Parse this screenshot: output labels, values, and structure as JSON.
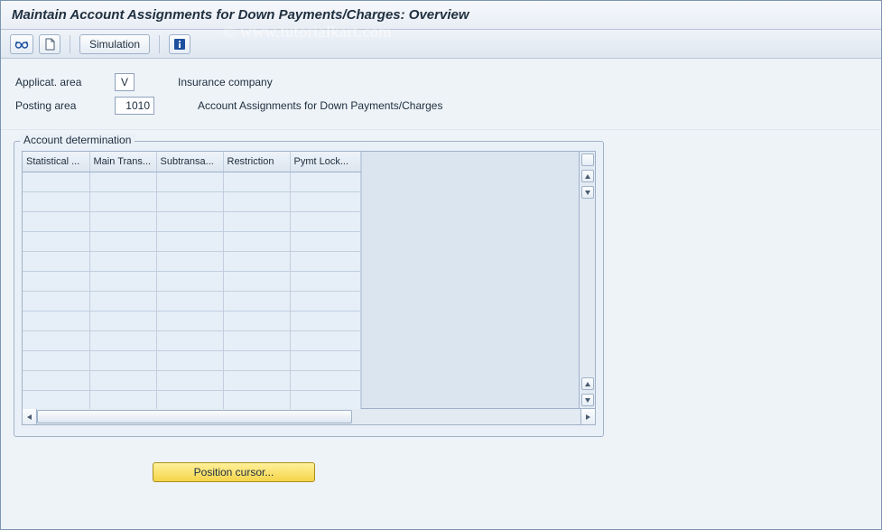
{
  "title": "Maintain Account Assignments for Down Payments/Charges: Overview",
  "watermark": "© www.tutorialkart.com",
  "toolbar": {
    "simulation_label": "Simulation"
  },
  "form": {
    "applicat_area": {
      "label": "Applicat. area",
      "value": "V",
      "desc": "Insurance company"
    },
    "posting_area": {
      "label": "Posting area",
      "value": "1010",
      "desc": "Account Assignments for Down Payments/Charges"
    }
  },
  "groupbox": {
    "title": "Account determination"
  },
  "table": {
    "columns": [
      "Statistical ...",
      "Main Trans...",
      "Subtransa...",
      "Restriction",
      "Pymt Lock..."
    ],
    "row_count": 12
  },
  "actions": {
    "position_cursor": "Position cursor..."
  }
}
